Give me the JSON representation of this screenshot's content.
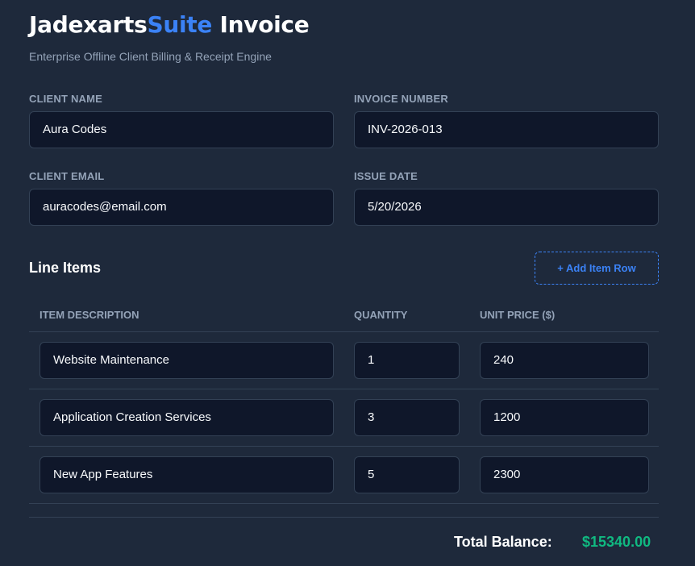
{
  "header": {
    "title_part1": "Jadexarts",
    "title_accent": "Suite",
    "title_part2": " Invoice",
    "subtitle": "Enterprise Offline Client Billing & Receipt Engine"
  },
  "form": {
    "client_name_label": "CLIENT NAME",
    "client_name_value": "Aura Codes",
    "invoice_number_label": "INVOICE NUMBER",
    "invoice_number_value": "INV-2026-013",
    "client_email_label": "CLIENT EMAIL",
    "client_email_value": "auracodes@email.com",
    "issue_date_label": "ISSUE DATE",
    "issue_date_value": "5/20/2026"
  },
  "line_items": {
    "title": "Line Items",
    "add_button_label": "+ Add Item Row",
    "columns": [
      "ITEM DESCRIPTION",
      "QUANTITY",
      "UNIT PRICE ($)"
    ],
    "rows": [
      {
        "description": "Website Maintenance",
        "quantity": "1",
        "unit_price": "240"
      },
      {
        "description": "Application Creation Services",
        "quantity": "3",
        "unit_price": "1200"
      },
      {
        "description": "New App Features",
        "quantity": "5",
        "unit_price": "2300"
      }
    ]
  },
  "totals": {
    "label": "Total Balance:",
    "value": "$15340.00",
    "value_color": "#10b981"
  },
  "colors": {
    "background": "#1e293b",
    "input_bg": "#0f172a",
    "accent": "#3b82f6"
  }
}
